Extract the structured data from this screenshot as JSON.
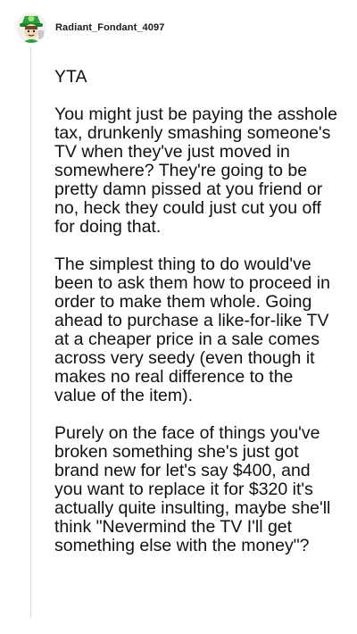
{
  "comment": {
    "author": "Radiant_Fondant_4097",
    "avatar_icon": "green-hat-cartoon-avatar-icon",
    "paragraphs": [
      "YTA",
      "You might just be paying the asshole tax, drunkenly smashing someone's TV when they've just moved in somewhere? They're going to be pretty damn pissed at you friend or no, heck they could just cut you off for doing that.",
      "The simplest thing to do would've been to ask them how to proceed in order to make them whole. Going ahead to purchase a like-for-like TV at a cheaper price in a sale comes across very seedy (even though it makes no real difference to the value of the item).",
      "Purely on the face of things you've broken something she's just got brand new for let's say $400, and you want to replace it for $320 it's actually quite insulting, maybe she'll think \"Nevermind the TV I'll get something else with the money\"?"
    ]
  }
}
